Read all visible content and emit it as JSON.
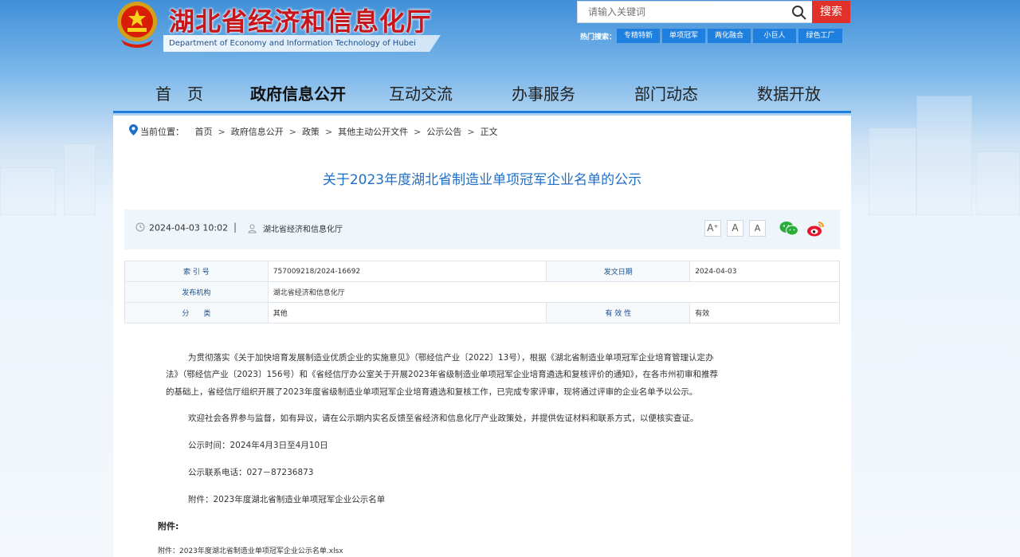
{
  "header": {
    "site_title": "湖北省经济和信息化厅",
    "site_subtitle": "Department of Economy and Information Technology of Hubei Province",
    "search": {
      "placeholder": "请输入关键词",
      "button": "搜索"
    },
    "hot_label": "热门搜索：",
    "hot_tags": [
      "专精特新",
      "单项冠军",
      "两化融合",
      "小巨人",
      "绿色工厂"
    ]
  },
  "nav": {
    "items": [
      "首　页",
      "政府信息公开",
      "互动交流",
      "办事服务",
      "部门动态",
      "数据开放"
    ],
    "active": "政府信息公开"
  },
  "breadcrumb": {
    "label": "当前位置：",
    "items": [
      "首页",
      "政府信息公开",
      "政策",
      "其他主动公开文件",
      "公示公告",
      "正文"
    ]
  },
  "article": {
    "title": "关于2023年度湖北省制造业单项冠军企业名单的公示",
    "date": "2024-04-03 10:02",
    "separator": "|",
    "publisher": "湖北省经济和信息化厅",
    "font_buttons": [
      "A⁺",
      "A",
      "A"
    ],
    "share": {
      "wechat_color": "#2aae3a",
      "weibo_color": "#e6162d"
    }
  },
  "info": {
    "index_label": "索 引 号",
    "index_value": "757009218/2024-16692",
    "date_label": "发文日期",
    "date_value": "2024-04-03",
    "org_label": "发布机构",
    "org_value": "湖北省经济和信息化厅",
    "category_label": "分　　类",
    "category_value": "其他",
    "validity_label": "有 效 性",
    "validity_value": "有效"
  },
  "body": {
    "p1_line1": "为贯彻落实《关于加快培育发展制造业优质企业的实施意见》（鄂经信产业〔2022〕13号），根据《湖北省制造业单项冠军企业培育管理认定办",
    "p1_line2": "法》（鄂经信产业〔2023〕156号）和《省经信厅办公室关于开展2023年省级制造业单项冠军企业培育遴选和复核评价的通知》，在各市州初审和推荐",
    "p1_line3": "的基础上，省经信厅组织开展了2023年度省级制造业单项冠军企业培育遴选和复核工作，已完成专家评审，现将通过评审的企业名单予以公示。",
    "p2": "欢迎社会各界参与监督，如有异议，请在公示期内实名反馈至省经济和信息化厅产业政策处，并提供佐证材料和联系方式，以便核实查证。",
    "p3": "公示时间：2024年4月3日至4月10日",
    "p4": "公示联系电话：027－87236873",
    "p5": "附件：2023年度湖北省制造业单项冠军企业公示名单",
    "attach_label": "附件:",
    "attach_file": "附件：2023年度湖北省制造业单项冠军企业公示名单.xlsx"
  }
}
